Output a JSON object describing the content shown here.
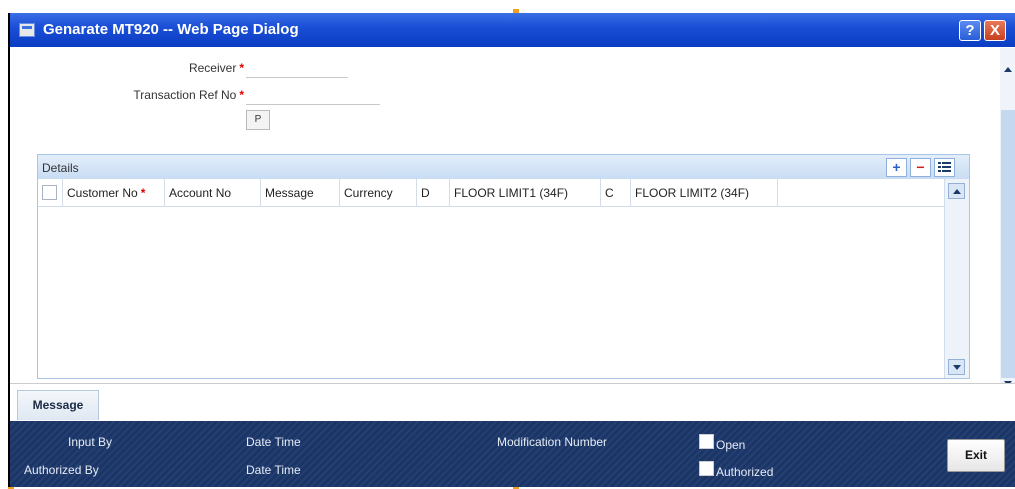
{
  "window": {
    "title": "Genarate MT920 -- Web Page Dialog",
    "help_label": "?",
    "close_label": "X"
  },
  "form": {
    "receiver_label": "Receiver",
    "transaction_ref_label": "Transaction Ref No",
    "receiver_value": "",
    "transaction_ref_value": "",
    "p_button_label": "P",
    "required_marker": "*"
  },
  "details": {
    "title": "Details",
    "add_label": "+",
    "remove_label": "−",
    "columns": [
      "Customer No",
      "Account No",
      "Message",
      "Currency",
      "D",
      "FLOOR LIMIT1 (34F)",
      "C",
      "FLOOR LIMIT2 (34F)"
    ],
    "rows": []
  },
  "tabs": {
    "message_label": "Message"
  },
  "footer": {
    "input_by_label": "Input By",
    "authorized_by_label": "Authorized By",
    "date_time_label_1": "Date Time",
    "date_time_label_2": "Date Time",
    "modification_number_label": "Modification Number",
    "open_label": "Open",
    "authorized_label": "Authorized",
    "exit_label": "Exit"
  },
  "colors": {
    "titlebar": "#1b4fd6",
    "footer": "#1b3565",
    "grid_header": "#c8dcf3",
    "required": "#e00000"
  }
}
